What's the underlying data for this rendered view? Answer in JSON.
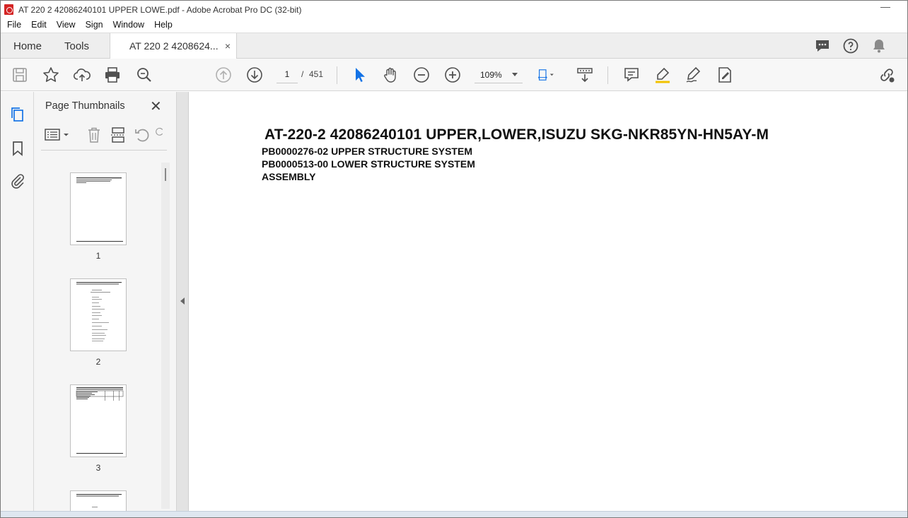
{
  "window": {
    "title": "AT 220 2 42086240101 UPPER LOWE.pdf - Adobe Acrobat Pro DC (32-bit)",
    "minimize_glyph": "—"
  },
  "menu": {
    "items": [
      "File",
      "Edit",
      "View",
      "Sign",
      "Window",
      "Help"
    ]
  },
  "tabs": {
    "home": "Home",
    "tools": "Tools",
    "document": "AT 220 2 4208624...",
    "close_glyph": "×"
  },
  "toolbar": {
    "current_page": "1",
    "page_separator": "/",
    "total_pages": "451",
    "zoom": "109%"
  },
  "panel": {
    "title": "Page Thumbnails",
    "close_glyph": "✕",
    "thumbnails": [
      {
        "label": "1"
      },
      {
        "label": "2"
      },
      {
        "label": "3"
      }
    ]
  },
  "document": {
    "title": "AT-220-2 42086240101 UPPER,LOWER,ISUZU SKG-NKR85YN-HN5AY-M",
    "lines": [
      "PB0000276-02 UPPER STRUCTURE SYSTEM",
      "PB0000513-00 LOWER STRUCTURE SYSTEM",
      "ASSEMBLY"
    ]
  },
  "colors": {
    "accent_blue": "#1473e6",
    "app_red": "#d42424",
    "icon_gray": "#505050"
  }
}
